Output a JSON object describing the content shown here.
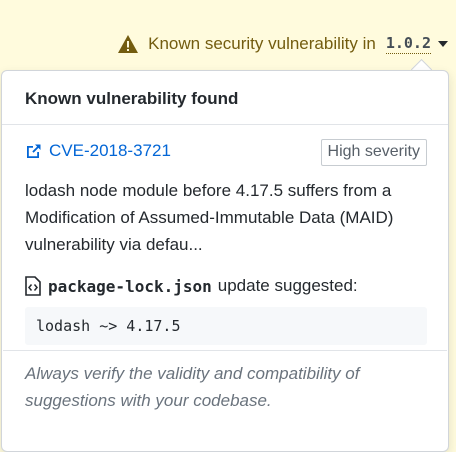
{
  "banner": {
    "icon": "warning-icon",
    "text": "Known security vulnerability in",
    "version": "1.0.2",
    "dropdown_icon": "caret-down-icon",
    "accent_color": "#735c0f",
    "background_color": "#fffbdd"
  },
  "popover": {
    "title": "Known vulnerability found",
    "cve": {
      "icon": "external-link-icon",
      "id": "CVE-2018-3721",
      "link_color": "#0366d6"
    },
    "severity": "High severity",
    "description": "lodash node module before 4.17.5 suffers from a Modification of Assumed-Immutable Data (MAID) vulnerability via defau...",
    "file": {
      "icon": "file-code-icon",
      "name": "package-lock.json",
      "suffix": "update suggested:"
    },
    "suggestion_code": "lodash ~> 4.17.5",
    "footer": "Always verify the validity and compatibility of suggestions with your codebase."
  }
}
